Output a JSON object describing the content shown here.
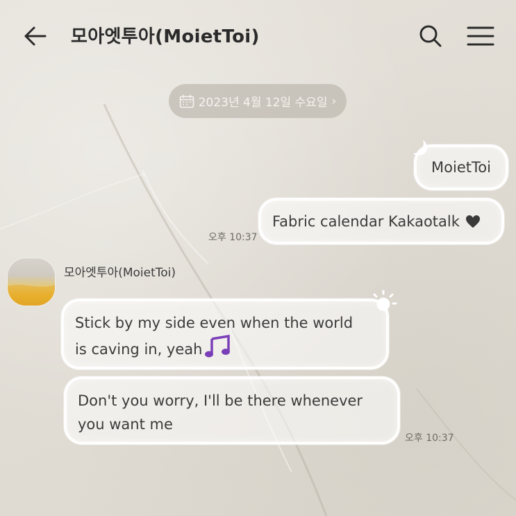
{
  "header": {
    "title": "모아엣투아(MoietToi)",
    "back_icon": "arrow-left-icon",
    "search_icon": "search-icon",
    "menu_icon": "hamburger-menu-icon"
  },
  "date_divider": {
    "text": "2023년 4월 12일 수요일",
    "chevron": "›",
    "icon": "calendar-icon"
  },
  "messages": {
    "sent": [
      {
        "text": "MoietToi"
      },
      {
        "text": "Fabric calendar Kakaotalk",
        "icon": "heart-icon"
      }
    ],
    "sent_time": "오후 10:37",
    "received": {
      "sender": "모아엣투아(MoietToi)",
      "avatar": "avatar-image",
      "items": [
        {
          "line1": "Stick by my side even when the world",
          "line2": "is caving in, yeah",
          "icon": "music-note-icon"
        },
        {
          "line1": "Don't you worry, I'll be there whenever",
          "line2": "you want me"
        }
      ],
      "time": "오후 10:37"
    }
  },
  "colors": {
    "background": "#e3dfd8",
    "bubble_border": "#ffffff",
    "text": "#3b3b3b",
    "pill": "#beb8af",
    "music_purple": "#7a3fb8",
    "heart": "#3a3a3a"
  }
}
